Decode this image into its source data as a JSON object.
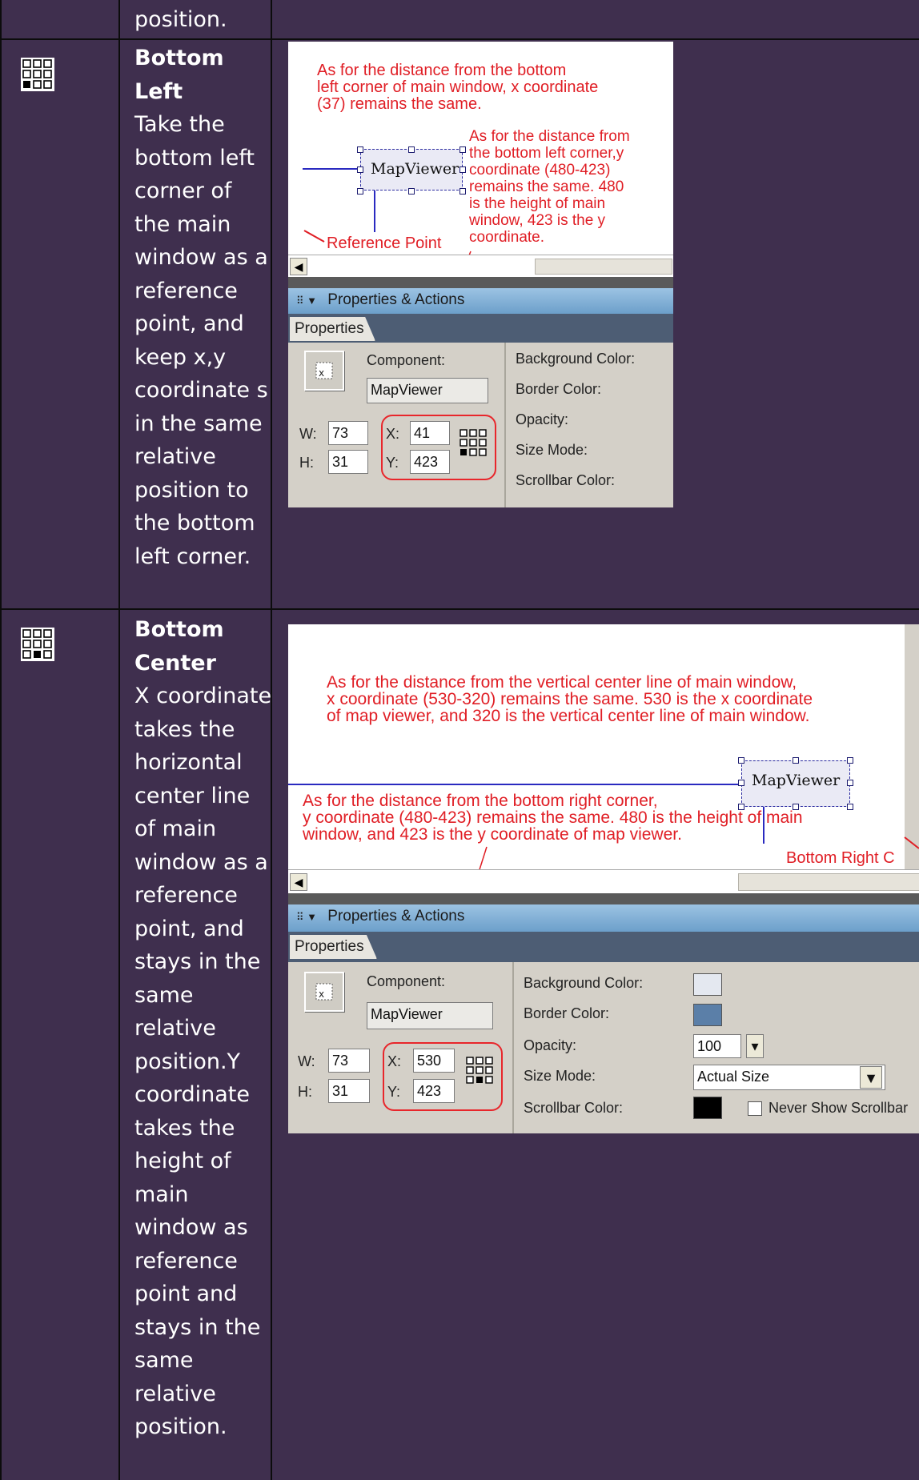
{
  "rows": [
    {
      "icon": "grid-anchor-icon-top-row",
      "text": "position."
    },
    {
      "icon": "grid-anchor-bottom-left-icon",
      "title": "Bottom Left",
      "description": "Take the bottom left corner of the main window as a reference point, and keep x,y coordinate s in the same relative position to the bottom left corner.",
      "screenshot": {
        "annotation_1": "As for the distance from the bottom\nleft corner of main window, x coordinate\n(37) remains the same.",
        "annotation_2": "As for the distance from\nthe bottom left corner,y\ncoordinate (480-423)\nremains the same. 480\nis the height of main\nwindow, 423 is the y\ncoordinate.",
        "reference_label": "Reference Point",
        "component_name": "MapViewer",
        "panel_title": "Properties & Actions",
        "tab": "Properties",
        "component_label": "Component:",
        "component_value": "MapViewer",
        "w_label": "W:",
        "w_value": "73",
        "h_label": "H:",
        "h_value": "31",
        "x_label": "X:",
        "x_value": "41",
        "y_label": "Y:",
        "y_value": "423",
        "right_labels": [
          "Background Color:",
          "Border Color:",
          "Opacity:",
          "Size Mode:",
          "Scrollbar Color:"
        ]
      }
    },
    {
      "icon": "grid-anchor-bottom-center-icon",
      "title": "Bottom Center",
      "description": "X coordinate takes the horizontal center line of main window as a reference point, and stays in the same relative position.Y coordinate takes the height of main window as reference point and stays in the same relative position.",
      "screenshot": {
        "annotation_1": "As for the distance from the vertical center line of main window,\nx coordinate (530-320) remains the same. 530 is the x coordinate\nof map viewer, and 320 is the vertical center line of main window.",
        "annotation_2": "As for the distance from the bottom right corner,\ny coordinate (480-423) remains the same. 480 is the height of main\nwindow, and 423 is the y coordinate of map viewer.",
        "corner_label": "Bottom Right C\norner",
        "component_name": "MapViewer",
        "panel_title": "Properties & Actions",
        "tab": "Properties",
        "component_label": "Component:",
        "component_value": "MapViewer",
        "w_label": "W:",
        "w_value": "73",
        "h_label": "H:",
        "h_value": "31",
        "x_label": "X:",
        "x_value": "530",
        "y_label": "Y:",
        "y_value": "423",
        "right_labels": [
          "Background Color:",
          "Border Color:",
          "Opacity:",
          "Size Mode:",
          "Scrollbar Color:"
        ],
        "opacity_value": "100",
        "size_mode_value": "Actual Size",
        "never_show_label": "Never Show Scrollbar"
      }
    }
  ],
  "colors": {
    "background": "#3f2f4e",
    "annotation": "#e01e25",
    "panel_bar": "#8db6da"
  }
}
